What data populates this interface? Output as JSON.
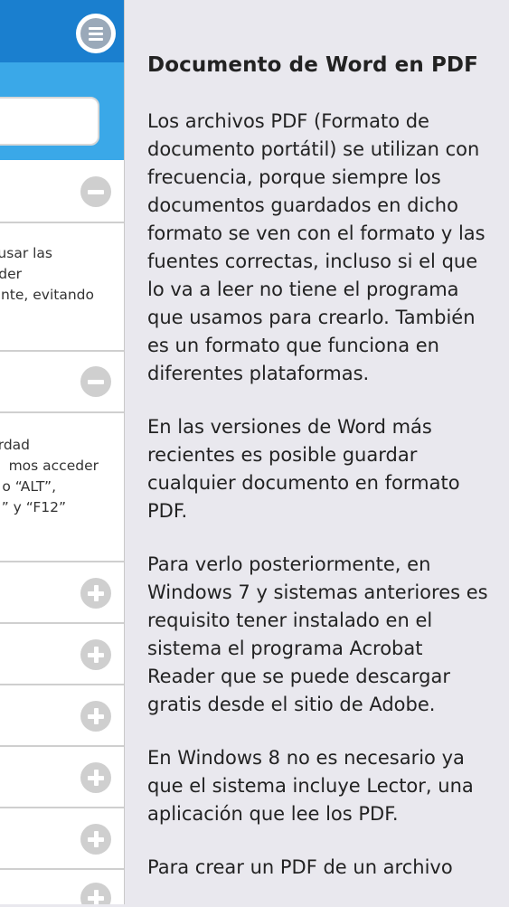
{
  "sidebar": {
    "search": {
      "placeholder": "",
      "value": ""
    },
    "sections": [
      {
        "state": "expanded",
        "toggle_icon": "minus-icon"
      },
      {
        "state": "expanded",
        "toggle_icon": "minus-icon"
      },
      {
        "state": "collapsed",
        "toggle_icon": "plus-icon"
      },
      {
        "state": "collapsed",
        "toggle_icon": "plus-icon"
      },
      {
        "state": "collapsed",
        "toggle_icon": "plus-icon"
      },
      {
        "state": "collapsed",
        "toggle_icon": "plus-icon"
      },
      {
        "state": "collapsed",
        "toggle_icon": "plus-icon"
      },
      {
        "state": "collapsed",
        "toggle_icon": "plus-icon"
      }
    ],
    "section1_lines": [
      "usar las",
      "der",
      "nte, evitando"
    ],
    "section2_lines": [
      "rdad",
      "mos acceder",
      "o “ALT”,",
      ".” y “F12”"
    ]
  },
  "article": {
    "title": "Documento de Word en PDF",
    "paragraphs": [
      "Los archivos PDF (Formato de documento portátil) se utilizan con frecuencia, porque siempre los documentos guardados en dicho formato se ven con el formato y las fuentes correctas, incluso si el que lo va a leer no tiene el programa que usamos para crearlo. También es un formato que funciona en diferentes plataformas.",
      "En las versiones de Word más recientes es posible guardar cualquier documento en formato PDF.",
      "Para verlo posteriormente, en Windows 7 y sistemas anteriores es requisito tener instalado en el sistema el programa Acrobat Reader que se puede descargar gratis desde el sitio de Adobe.",
      "En Windows 8 no es necesario ya que el sistema incluye Lector, una aplicación que lee los PDF.",
      "Para crear un PDF de un archivo"
    ]
  },
  "colors": {
    "header_blue": "#1a7fcf",
    "search_blue": "#3aa8e8",
    "background": "#e9e8ee",
    "toggle_grey": "#cfcfcf"
  }
}
